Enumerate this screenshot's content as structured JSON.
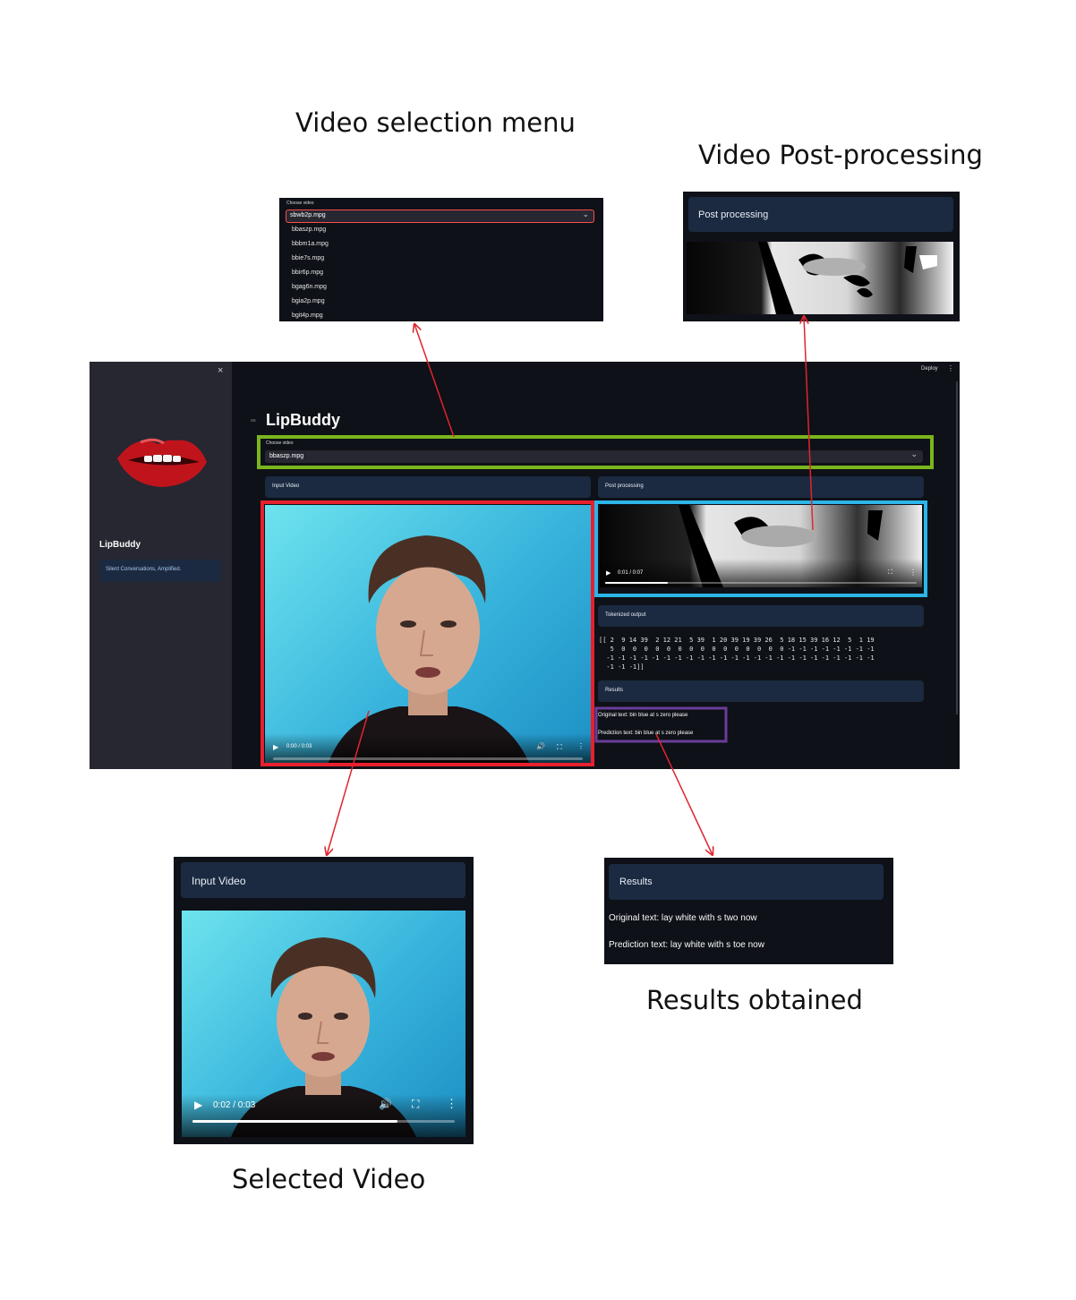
{
  "captions": {
    "menu": "Video selection menu",
    "post": "Video Post-processing",
    "selected": "Selected Video",
    "results": "Results obtained"
  },
  "app": {
    "title": "LipBuddy",
    "deploy": "Deploy",
    "close_symbol": "×",
    "menu_symbol": "⋮",
    "link_symbol": "🔗",
    "sidebar": {
      "title": "LipBuddy",
      "tagline": "Silent Conversations, Amplified."
    },
    "select": {
      "label": "Choose video",
      "value": "bbaszp.mpg",
      "chevron": "⌄"
    },
    "sections": {
      "input": "Input Video",
      "post": "Post processing",
      "tokens": "Tokenized output",
      "results": "Results"
    },
    "input_player": {
      "time": "0:00 / 0:03",
      "progress": 0.0
    },
    "post_player": {
      "time": "0:01 / 0:07",
      "progress": 0.2
    },
    "tokens_lines": [
      "[[ 2  9 14 39  2 12 21  5 39  1 20 39 19 39 26  5 18 15 39 16 12  5  1 19",
      "   5  0  0  0  0  0  0  0  0  0  0  0  0  0  0  0 -1 -1 -1 -1 -1 -1 -1 -1",
      "  -1 -1 -1 -1 -1 -1 -1 -1 -1 -1 -1 -1 -1 -1 -1 -1 -1 -1 -1 -1 -1 -1 -1 -1",
      "  -1 -1 -1]]"
    ],
    "results": {
      "original": "Original text: bin blue at s zero please",
      "prediction": "Prediction text: bin blue at s zero please"
    }
  },
  "menu_crop": {
    "label": "Choose video",
    "value": "sbwb2p.mpg",
    "chevron": "⌄",
    "options": [
      "bbaszp.mpg",
      "bbbm1a.mpg",
      "bbie7s.mpg",
      "bbir6p.mpg",
      "bgag6n.mpg",
      "bgia2p.mpg",
      "bgit4p.mpg"
    ]
  },
  "post_crop": {
    "header": "Post processing"
  },
  "input_crop": {
    "header": "Input Video",
    "time": "0:02 / 0:03",
    "progress": 0.78
  },
  "results_crop": {
    "header": "Results",
    "original": "Original text: lay white with s two now",
    "prediction": "Prediction text: lay white with s toe now"
  },
  "colors": {
    "green_box": "#7ab51d",
    "red_box": "#e8202e",
    "blue_box": "#2bb6ea",
    "purple_box": "#6a3d9a",
    "arrow": "#e0242f"
  }
}
